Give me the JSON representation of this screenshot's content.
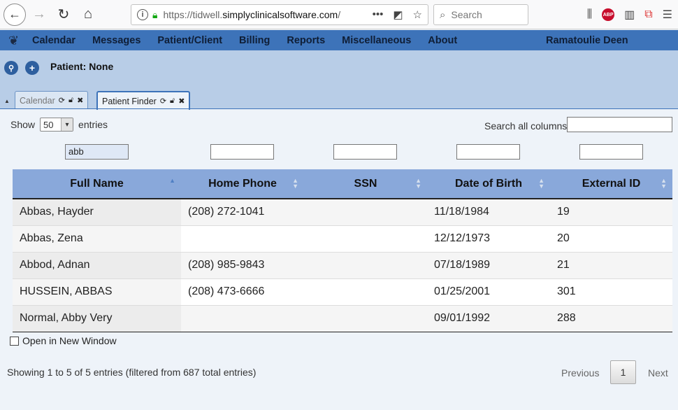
{
  "browser": {
    "url_prefix": "https://tidwell.",
    "url_domain": "simplyclinicalsoftware.com",
    "url_suffix": "/",
    "search_placeholder": "Search"
  },
  "nav": {
    "items": [
      "Calendar",
      "Messages",
      "Patient/Client",
      "Billing",
      "Reports",
      "Miscellaneous",
      "About"
    ],
    "user": "Ramatoulie Deen"
  },
  "header": {
    "patient_label": "Patient: None"
  },
  "tabs": [
    {
      "label": "Calendar",
      "active": false
    },
    {
      "label": "Patient Finder",
      "active": true
    }
  ],
  "table_controls": {
    "show_label": "Show",
    "page_size": "50",
    "entries_label": "entries",
    "search_label": "Search all columns:",
    "search_value": ""
  },
  "filters": [
    "abb",
    "",
    "",
    "",
    ""
  ],
  "columns": [
    "Full Name",
    "Home Phone",
    "SSN",
    "Date of Birth",
    "External ID"
  ],
  "rows": [
    [
      "Abbas, Hayder",
      "(208) 272-1041",
      "",
      "11/18/1984",
      "19"
    ],
    [
      "Abbas, Zena",
      "",
      "",
      "12/12/1973",
      "20"
    ],
    [
      "Abbod, Adnan",
      "(208) 985-9843",
      "",
      "07/18/1989",
      "21"
    ],
    [
      "HUSSEIN, ABBAS",
      "(208) 473-6666",
      "",
      "01/25/2001",
      "301"
    ],
    [
      "Normal, Abby Very",
      "",
      "",
      "09/01/1992",
      "288"
    ]
  ],
  "open_new_window_label": "Open in New Window",
  "footer": {
    "info": "Showing 1 to 5 of 5 entries (filtered from 687 total entries)",
    "previous": "Previous",
    "page": "1",
    "next": "Next"
  }
}
